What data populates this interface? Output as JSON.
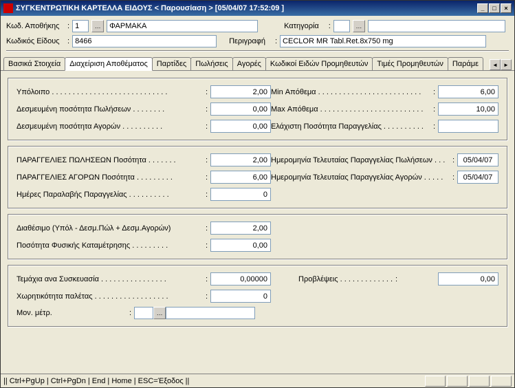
{
  "titlebar": {
    "text": "ΣΥΓΚΕΝΤΡΩΤΙΚΗ ΚΑΡΤΕΛΛΑ ΕΙΔΟΥΣ < Παρουσίαση >    [05/04/07 17:52:09  ]"
  },
  "header": {
    "warehouse_label": "Κωδ. Αποθήκης",
    "warehouse_code": "1",
    "warehouse_name": "ΦΑΡΜΑΚΑ",
    "category_label": "Κατηγορία",
    "category_value": "",
    "itemcode_label": "Κωδικός Είδους",
    "itemcode_value": "8466",
    "description_label": "Περιγραφή",
    "description_value": "CECLOR MR Tabl.Ret.8x750 mg"
  },
  "tabs": {
    "t0": "Βασικά Στοιχεία",
    "t1": "Διαχείριση Αποθέματος",
    "t2": "Παρτίδες",
    "t3": "Πωλήσεις",
    "t4": "Αγορές",
    "t5": "Κωδικοί Ειδών Προμηθευτών",
    "t6": "Τιμές Προμηθευτών",
    "t7": "Παράμε"
  },
  "g1": {
    "balance_label": "Υπόλοιπο . . . . . . . . . . . . . . . . . . . . . . . . . . . .",
    "balance_value": "2,00",
    "reserved_sales_label": "Δεσμευμένη ποσότητα Πωλήσεων . . . . . . . .",
    "reserved_sales_value": "0,00",
    "reserved_purch_label": "Δεσμευμένη ποσότητα Αγορών . . . . . . . . . .",
    "reserved_purch_value": "0,00",
    "min_stock_label": "Min Απόθεμα . . . . . . . . . . . . . . . . . . . . . . . . .",
    "min_stock_value": "6,00",
    "max_stock_label": "Max Απόθεμα . . . . . . . . . . . . . . . . . . . . . . . . .",
    "max_stock_value": "10,00",
    "min_order_label": "Ελάχιστη Ποσότητα Παραγγελίας . . . . . . . . . .",
    "min_order_value": ""
  },
  "g2": {
    "sales_orders_label": "ΠΑΡΑΓΓΕΛΙΕΣ ΠΩΛΗΣΕΩΝ Ποσότητα . . . . . . .",
    "sales_orders_value": "2,00",
    "purch_orders_label": "ΠΑΡΑΓΓΕΛΙΕΣ ΑΓΟΡΩΝ Ποσότητα . . . . . . . . .",
    "purch_orders_value": "6,00",
    "days_receive_label": "Ημέρες Παραλαβής Παραγγελίας . . . . . . . . . .",
    "days_receive_value": "0",
    "last_sales_date_label": "Ημερομηνία Τελευταίας Παραγγελίας Πωλήσεων . . .",
    "last_sales_date_value": "05/04/07",
    "last_purch_date_label": "Ημερομηνία Τελευταίας Παραγγελίας Αγορών . . . . .",
    "last_purch_date_value": "05/04/07"
  },
  "g3": {
    "available_label": "Διαθέσιμο (Υπόλ - Δεσμ.Πώλ + Δεσμ.Αγορών)",
    "available_value": "2,00",
    "physical_label": "Ποσότητα Φυσικής Καταμέτρησης . . . . . . . . .",
    "physical_value": "0,00"
  },
  "g4": {
    "pieces_label": "Τεμάχια ανα Συσκευασία . . . . . . . . . . . . . . . .",
    "pieces_value": "0,00000",
    "pallet_label": "Χωρητικότητα παλέτας . . . . . . . . . . . . . . . . . .",
    "pallet_value": "0",
    "uom_label": "Μον. μέτρ.",
    "uom_value": "",
    "forecast_label": "Προβλέψεις . . . . . . . . . . . . .",
    "forecast_value": "0,00"
  },
  "statusbar": {
    "text": "|| Ctrl+PgUp | Ctrl+PgDn | End | Home | ESC=Έξοδος ||"
  }
}
